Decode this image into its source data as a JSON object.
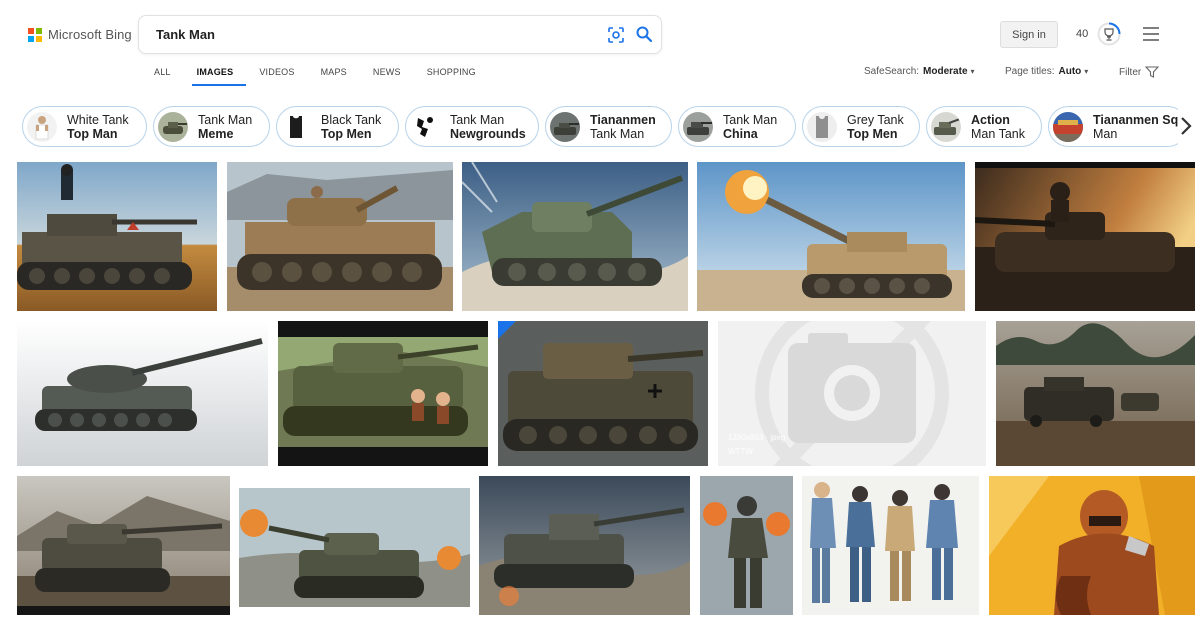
{
  "brand": {
    "name": "Microsoft Bing"
  },
  "search": {
    "query": "Tank Man"
  },
  "header": {
    "sign_in": "Sign in",
    "points": "40"
  },
  "nav": {
    "tabs": [
      "ALL",
      "IMAGES",
      "VIDEOS",
      "MAPS",
      "NEWS",
      "SHOPPING"
    ],
    "active": "IMAGES"
  },
  "filters": {
    "safesearch_label": "SafeSearch:",
    "safesearch_value": "Moderate",
    "page_titles_label": "Page titles:",
    "page_titles_value": "Auto",
    "filter_label": "Filter"
  },
  "related": [
    {
      "line1": "White Tank",
      "line2": "Top Man",
      "bold": 2
    },
    {
      "line1": "Tank Man",
      "line2": "Meme",
      "bold": 2
    },
    {
      "line1": "Black Tank",
      "line2": "Top Men",
      "bold": 2
    },
    {
      "line1": "Tank Man",
      "line2": "Newgrounds",
      "bold": 2
    },
    {
      "line1": "Tiananmen",
      "line2": "Tank Man",
      "bold": 1
    },
    {
      "line1": "Tank Man",
      "line2": "China",
      "bold": 2
    },
    {
      "line1": "Grey Tank",
      "line2": "Top Men",
      "bold": 2
    },
    {
      "line1": "Action",
      "line2": "Man Tank",
      "bold": 1
    },
    {
      "line1": "Tiananmen Sq",
      "line2": "Man",
      "bold": 1
    }
  ],
  "placeholder": {
    "dims": "1280x853 · jpeg",
    "source": "WTTW"
  },
  "colors": {
    "accent": "#1a73e8",
    "chip_border": "#b8d3ea",
    "ms_red": "#f25022",
    "ms_green": "#7fba00",
    "ms_blue": "#00a4ef",
    "ms_yellow": "#ffb900"
  }
}
